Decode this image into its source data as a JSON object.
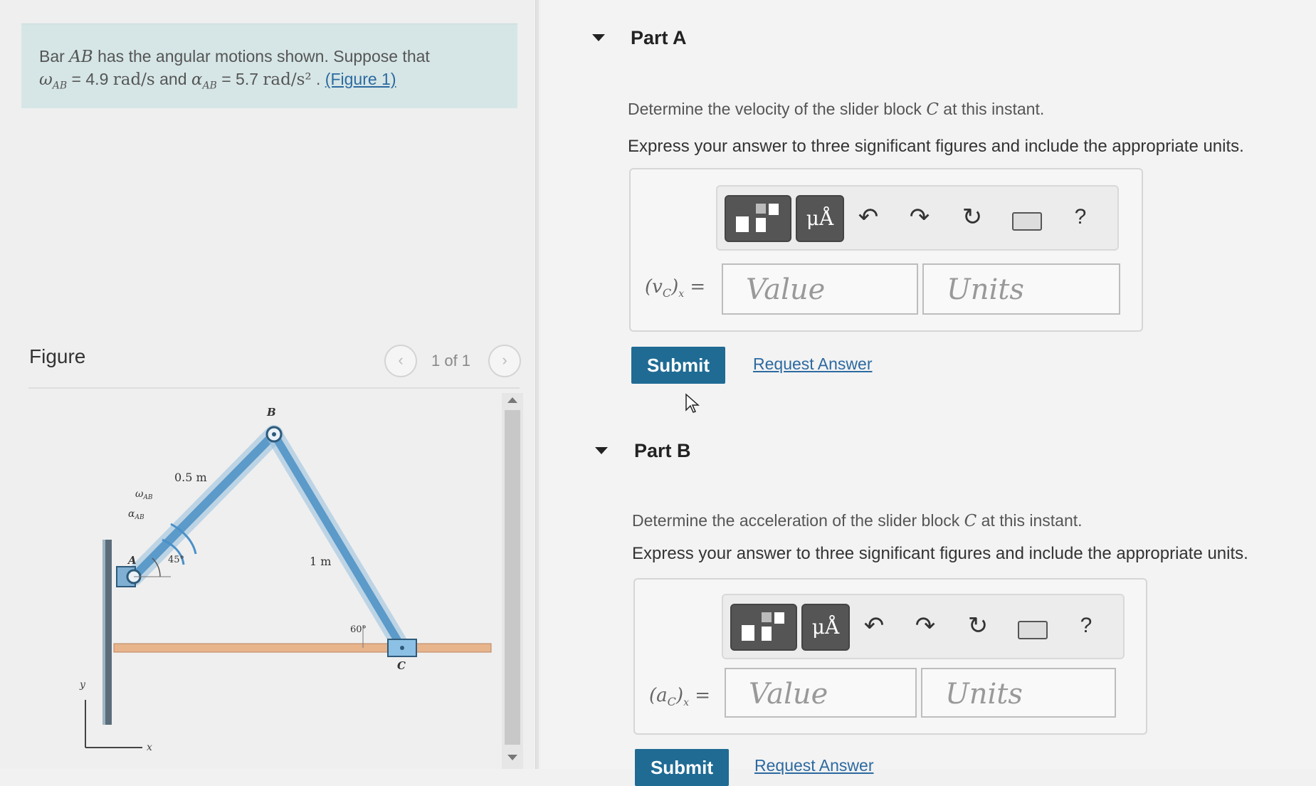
{
  "problem": {
    "line1_pre": "Bar ",
    "line1_bar": "AB",
    "line1_post": " has the angular motions shown. Suppose that",
    "omega_symbol": "ω",
    "omega_sub": "AB",
    "omega_value": " = 4.9 ",
    "omega_unit": "rad/s",
    "and_text": " and ",
    "alpha_symbol": "α",
    "alpha_sub": "AB",
    "alpha_value": " = 5.7 ",
    "alpha_unit": "rad/s²",
    "sep": " . ",
    "figure_link": "(Figure 1)"
  },
  "figure_panel": {
    "label": "Figure",
    "counter": "1 of 1",
    "prev_icon": "chevron-left-icon",
    "next_icon": "chevron-right-icon",
    "diagram": {
      "labels": {
        "B": "B",
        "A": "A",
        "C": "C",
        "len_ab": "0.5 m",
        "len_bc": "1 m",
        "angle_a": "45°",
        "angle_c": "60°",
        "omega": "ω",
        "omega_sub": "AB",
        "alpha": "α",
        "alpha_sub": "AB",
        "x_axis": "x",
        "y_axis": "y"
      }
    }
  },
  "part_a": {
    "title": "Part A",
    "question_pre": "Determine the velocity of the slider block ",
    "question_var": "C",
    "question_post": " at this instant.",
    "instruction": "Express your answer to three significant figures and include the appropriate units.",
    "label": "(v",
    "label_sub": "C",
    "label_end": ")",
    "label_xsub": "x",
    "label_eq": " =",
    "value_placeholder": "Value",
    "units_placeholder": "Units",
    "submit": "Submit",
    "request": "Request Answer"
  },
  "part_b": {
    "title": "Part B",
    "question_pre": "Determine the acceleration of the slider block ",
    "question_var": "C",
    "question_post": " at this instant.",
    "instruction": "Express your answer to three significant figures and include the appropriate units.",
    "label": "(a",
    "label_sub": "C",
    "label_end": ")",
    "label_xsub": "x",
    "label_eq": " =",
    "value_placeholder": "Value",
    "units_placeholder": "Units",
    "submit": "Submit",
    "request": "Request Answer"
  },
  "toolbar": {
    "units_button": "μÅ",
    "help": "?",
    "icons": [
      "templates-icon",
      "units-icon",
      "undo-icon",
      "redo-icon",
      "reset-icon",
      "keyboard-icon",
      "help-icon"
    ]
  },
  "colors": {
    "accent": "#1f6b94",
    "link": "#2c6aa0",
    "problem_bg": "#d6e6e6",
    "bar_blue": "#5b9ac9",
    "ground": "#e8b48c"
  }
}
